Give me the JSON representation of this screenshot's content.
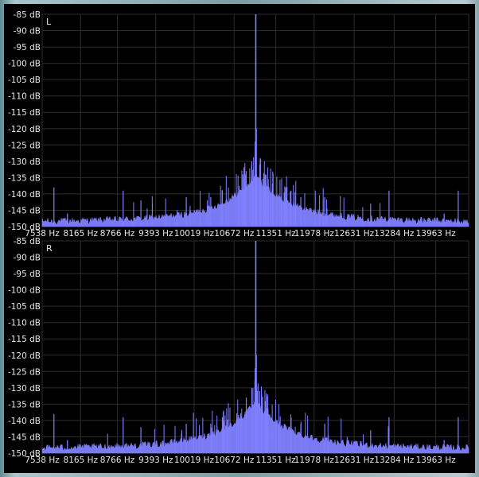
{
  "chart_data": [
    {
      "type": "line",
      "channel_label": "L",
      "color": "#8080ff",
      "ylabel_ticks": [
        "-85 dB",
        "-90 dB",
        "-95 dB",
        "-100 dB",
        "-105 dB",
        "-110 dB",
        "-115 dB",
        "-120 dB",
        "-125 dB",
        "-130 dB",
        "-135 dB",
        "-140 dB",
        "-145 dB",
        "-150 dB"
      ],
      "ylim": [
        -150,
        -85
      ],
      "xlabel_ticks": [
        "7538 Hz",
        "8165 Hz",
        "8766 Hz",
        "9393 Hz",
        "10019 Hz",
        "10672 Hz",
        "11351 Hz",
        "11978 Hz",
        "12631 Hz",
        "13284 Hz",
        "13963 Hz"
      ],
      "xlim": [
        7538,
        14500
      ],
      "grid": true,
      "peaks": [
        {
          "x": 11025,
          "y": -85
        },
        {
          "x": 11035,
          "y": -120
        },
        {
          "x": 11015,
          "y": -124
        },
        {
          "x": 10960,
          "y": -130
        },
        {
          "x": 11090,
          "y": -131
        },
        {
          "x": 10870,
          "y": -133
        },
        {
          "x": 11180,
          "y": -134
        },
        {
          "x": 10480,
          "y": -139
        },
        {
          "x": 11600,
          "y": -139
        },
        {
          "x": 9890,
          "y": -141
        },
        {
          "x": 12150,
          "y": -141
        },
        {
          "x": 8860,
          "y": -139
        },
        {
          "x": 13200,
          "y": -139
        },
        {
          "x": 7730,
          "y": -138
        },
        {
          "x": 14330,
          "y": -139
        },
        {
          "x": 10290,
          "y": -141
        },
        {
          "x": 11760,
          "y": -141
        },
        {
          "x": 9150,
          "y": -142
        },
        {
          "x": 12900,
          "y": -143
        },
        {
          "x": 7950,
          "y": -146
        },
        {
          "x": 14100,
          "y": -146
        }
      ],
      "noise_floor": -149,
      "center_hz": 11025
    },
    {
      "type": "line",
      "channel_label": "R",
      "color": "#8080ff",
      "ylabel_ticks": [
        "-85 dB",
        "-90 dB",
        "-95 dB",
        "-100 dB",
        "-105 dB",
        "-110 dB",
        "-115 dB",
        "-120 dB",
        "-125 dB",
        "-130 dB",
        "-135 dB",
        "-140 dB",
        "-145 dB",
        "-150 dB"
      ],
      "ylim": [
        -150,
        -85
      ],
      "xlabel_ticks": [
        "7538 Hz",
        "8165 Hz",
        "8766 Hz",
        "9393 Hz",
        "10019 Hz",
        "10672 Hz",
        "11351 Hz",
        "11978 Hz",
        "12631 Hz",
        "13284 Hz",
        "13963 Hz"
      ],
      "xlim": [
        7538,
        14500
      ],
      "grid": true,
      "peaks": [
        {
          "x": 11025,
          "y": -85
        },
        {
          "x": 11035,
          "y": -120
        },
        {
          "x": 11015,
          "y": -124
        },
        {
          "x": 10960,
          "y": -130
        },
        {
          "x": 11090,
          "y": -131
        },
        {
          "x": 10870,
          "y": -133
        },
        {
          "x": 11180,
          "y": -134
        },
        {
          "x": 10480,
          "y": -139
        },
        {
          "x": 11600,
          "y": -139
        },
        {
          "x": 9890,
          "y": -141
        },
        {
          "x": 12150,
          "y": -141
        },
        {
          "x": 8860,
          "y": -139
        },
        {
          "x": 13200,
          "y": -139
        },
        {
          "x": 7730,
          "y": -138
        },
        {
          "x": 14330,
          "y": -139
        },
        {
          "x": 10290,
          "y": -141
        },
        {
          "x": 11760,
          "y": -141
        },
        {
          "x": 9150,
          "y": -142
        },
        {
          "x": 12900,
          "y": -143
        },
        {
          "x": 7950,
          "y": -146
        },
        {
          "x": 14100,
          "y": -146
        }
      ],
      "noise_floor": -149,
      "center_hz": 11025
    }
  ]
}
